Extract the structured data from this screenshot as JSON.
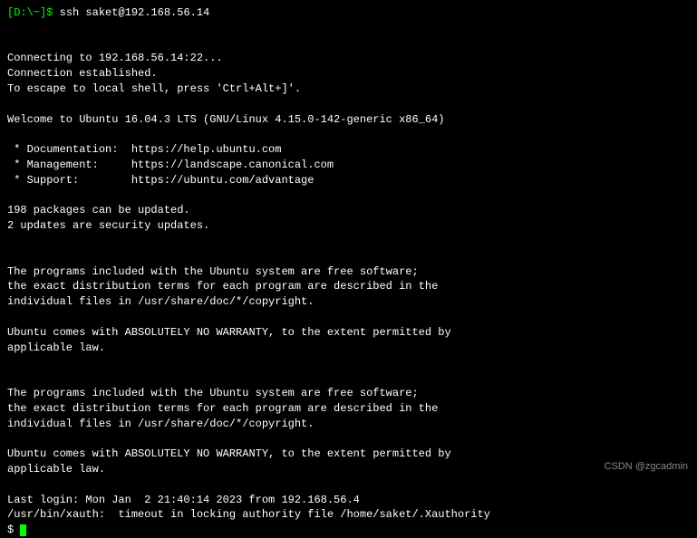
{
  "prompt": {
    "location": "[D:\\~]",
    "dollar": "$ ",
    "command": "ssh saket@192.168.56.14"
  },
  "lines": {
    "connecting": "Connecting to 192.168.56.14:22...",
    "established": "Connection established.",
    "escape": "To escape to local shell, press 'Ctrl+Alt+]'.",
    "welcome": "Welcome to Ubuntu 16.04.3 LTS (GNU/Linux 4.15.0-142-generic x86_64)",
    "doc": " * Documentation:  https://help.ubuntu.com",
    "mgmt": " * Management:     https://landscape.canonical.com",
    "support": " * Support:        https://ubuntu.com/advantage",
    "packages": "198 packages can be updated.",
    "security": "2 updates are security updates.",
    "programs1": "The programs included with the Ubuntu system are free software;",
    "programs2": "the exact distribution terms for each program are described in the",
    "programs3": "individual files in /usr/share/doc/*/copyright.",
    "warranty1": "Ubuntu comes with ABSOLUTELY NO WARRANTY, to the extent permitted by",
    "warranty2": "applicable law.",
    "lastlogin": "Last login: Mon Jan  2 21:40:14 2023 from 192.168.56.4",
    "xauth": "/usr/bin/xauth:  timeout in locking authority file /home/saket/.Xauthority",
    "finalprompt": "$ "
  },
  "watermark": "CSDN @zgcadmin"
}
